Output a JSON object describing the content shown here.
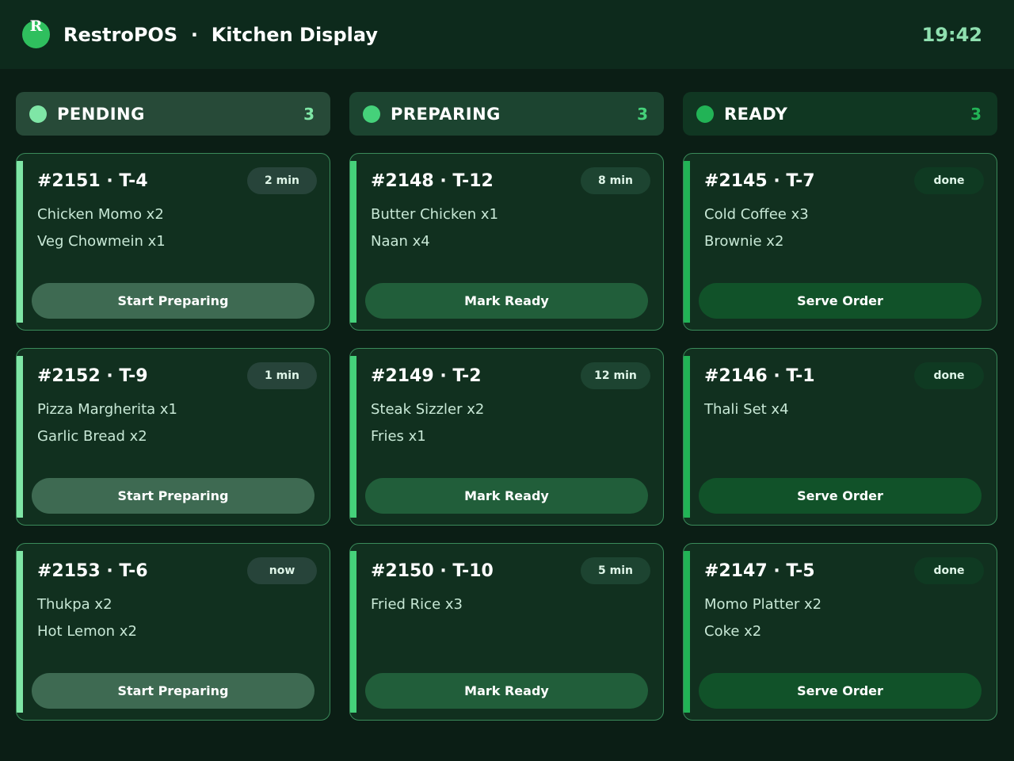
{
  "header": {
    "logo_letter": "R",
    "app_name": "RestroPOS",
    "separator": "·",
    "screen_name": "Kitchen Display",
    "clock": "19:42"
  },
  "colors": {
    "pending_accent": "#7fe6a6",
    "preparing_accent": "#45d17a",
    "ready_accent": "#22b356"
  },
  "columns": [
    {
      "key": "pending",
      "title": "PENDING",
      "count": "3",
      "orders": [
        {
          "id": "#2151 · T-4",
          "time": "2 min",
          "items": [
            "Chicken Momo x2",
            "Veg Chowmein x1"
          ],
          "action": "Start Preparing"
        },
        {
          "id": "#2152 · T-9",
          "time": "1 min",
          "items": [
            "Pizza Margherita x1",
            "Garlic Bread x2"
          ],
          "action": "Start Preparing"
        },
        {
          "id": "#2153 · T-6",
          "time": "now",
          "items": [
            "Thukpa x2",
            "Hot Lemon x2"
          ],
          "action": "Start Preparing"
        }
      ]
    },
    {
      "key": "preparing",
      "title": "PREPARING",
      "count": "3",
      "orders": [
        {
          "id": "#2148 · T-12",
          "time": "8 min",
          "items": [
            "Butter Chicken x1",
            "Naan x4"
          ],
          "action": "Mark Ready"
        },
        {
          "id": "#2149 · T-2",
          "time": "12 min",
          "items": [
            "Steak Sizzler x2",
            "Fries x1"
          ],
          "action": "Mark Ready"
        },
        {
          "id": "#2150 · T-10",
          "time": "5 min",
          "items": [
            "Fried Rice x3"
          ],
          "action": "Mark Ready"
        }
      ]
    },
    {
      "key": "ready",
      "title": "READY",
      "count": "3",
      "orders": [
        {
          "id": "#2145 · T-7",
          "time": "done",
          "items": [
            "Cold Coffee x3",
            "Brownie x2"
          ],
          "action": "Serve Order"
        },
        {
          "id": "#2146 · T-1",
          "time": "done",
          "items": [
            "Thali Set x4"
          ],
          "action": "Serve Order"
        },
        {
          "id": "#2147 · T-5",
          "time": "done",
          "items": [
            "Momo Platter x2",
            "Coke x2"
          ],
          "action": "Serve Order"
        }
      ]
    }
  ]
}
